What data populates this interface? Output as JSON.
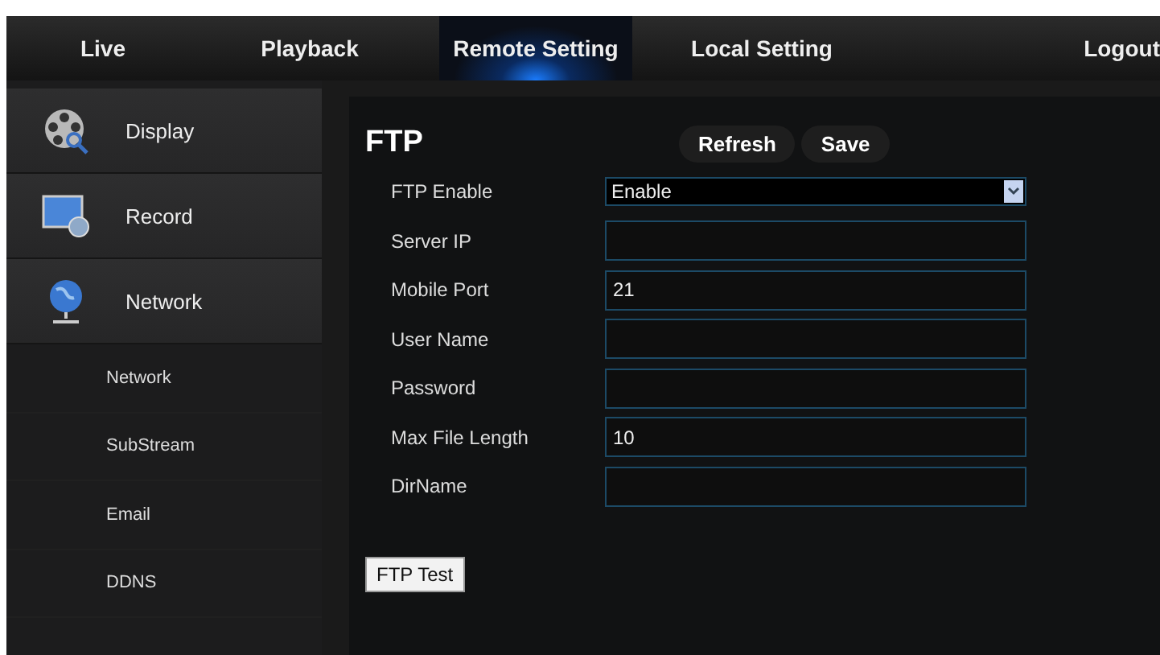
{
  "nav": [
    {
      "label": "Live",
      "selected": false
    },
    {
      "label": "Playback",
      "selected": false
    },
    {
      "label": "Remote Setting",
      "selected": true
    },
    {
      "label": "Local Setting",
      "selected": false
    },
    {
      "label": "Logout",
      "selected": false
    }
  ],
  "sidebar": {
    "items": [
      {
        "kind": "display",
        "label": "Display"
      },
      {
        "kind": "record",
        "label": "Record"
      },
      {
        "kind": "network",
        "label": "Network",
        "children": [
          {
            "label": "Network"
          },
          {
            "label": "SubStream"
          },
          {
            "label": "Email"
          },
          {
            "label": "DDNS"
          }
        ]
      }
    ]
  },
  "panel": {
    "title": "FTP",
    "buttons": [
      "Refresh",
      "Save"
    ],
    "fields": [
      {
        "label": "FTP Enable",
        "kind": "select",
        "value": "Enable"
      },
      {
        "label": "Server IP",
        "kind": "text"
      },
      {
        "label": "Mobile Port",
        "kind": "text",
        "value": "21"
      },
      {
        "label": "User Name",
        "kind": "text"
      },
      {
        "label": "Password",
        "kind": "text"
      },
      {
        "label": "Max File Length",
        "kind": "text",
        "value": "10"
      },
      {
        "label": "DirName",
        "kind": "text"
      }
    ],
    "test_button": "FTP Test"
  }
}
